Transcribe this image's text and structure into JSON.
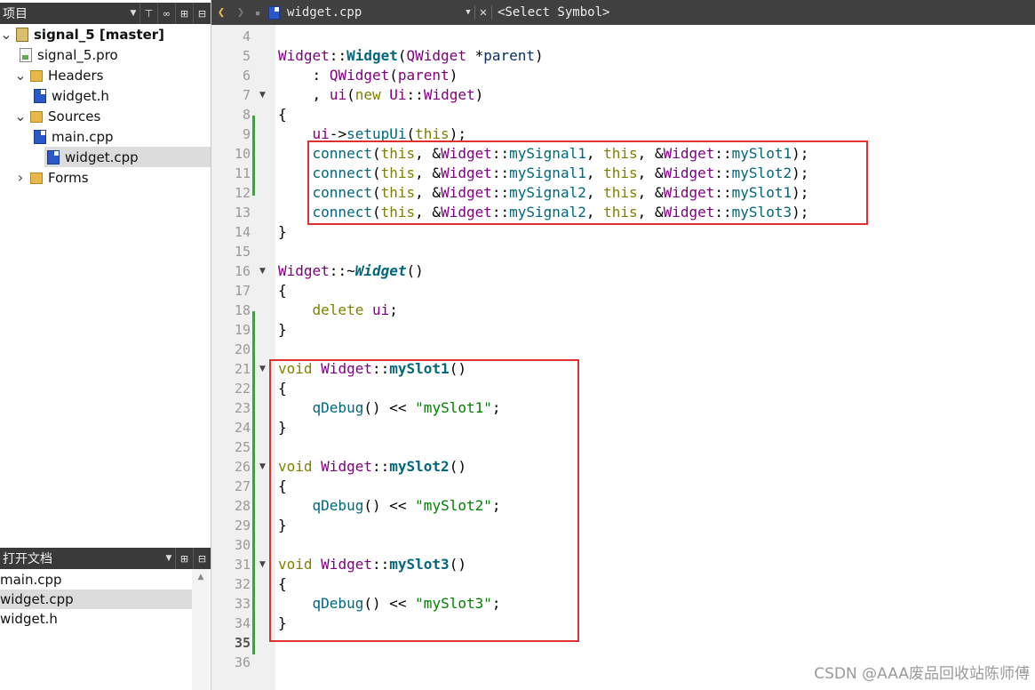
{
  "project_panel": {
    "title": "项目",
    "tree": [
      {
        "label": "signal_5 [master]",
        "icon": "project-icon",
        "expanded": true
      },
      {
        "label": "signal_5.pro",
        "icon": "pro-file-icon"
      },
      {
        "label": "Headers",
        "icon": "headers-folder-icon",
        "expanded": true
      },
      {
        "label": "widget.h",
        "icon": "cpp-file-icon"
      },
      {
        "label": "Sources",
        "icon": "sources-folder-icon",
        "expanded": true
      },
      {
        "label": "main.cpp",
        "icon": "cpp-file-icon"
      },
      {
        "label": "widget.cpp",
        "icon": "cpp-file-icon",
        "selected": true
      },
      {
        "label": "Forms",
        "icon": "forms-folder-icon",
        "expanded": false
      }
    ]
  },
  "open_docs": {
    "title": "打开文档",
    "items": [
      "main.cpp",
      "widget.cpp",
      "widget.h"
    ],
    "selected": "widget.cpp"
  },
  "editor": {
    "file_tab": "widget.cpp",
    "symbol_select": "<Select Symbol>",
    "current_line": "35",
    "lines": [
      {
        "n": "4",
        "t": ""
      },
      {
        "n": "5",
        "t": "Widget::Widget(QWidget *parent)"
      },
      {
        "n": "6",
        "t": "    : QWidget(parent)"
      },
      {
        "n": "7",
        "t": "    , ui(new Ui::Widget)"
      },
      {
        "n": "8",
        "t": "{"
      },
      {
        "n": "9",
        "t": "    ui->setupUi(this);"
      },
      {
        "n": "10",
        "t": "    connect(this, &Widget::mySignal1, this, &Widget::mySlot1);"
      },
      {
        "n": "11",
        "t": "    connect(this, &Widget::mySignal1, this, &Widget::mySlot2);"
      },
      {
        "n": "12",
        "t": "    connect(this, &Widget::mySignal2, this, &Widget::mySlot1);"
      },
      {
        "n": "13",
        "t": "    connect(this, &Widget::mySignal2, this, &Widget::mySlot3);"
      },
      {
        "n": "14",
        "t": "}"
      },
      {
        "n": "15",
        "t": ""
      },
      {
        "n": "16",
        "t": "Widget::~Widget()"
      },
      {
        "n": "17",
        "t": "{"
      },
      {
        "n": "18",
        "t": "    delete ui;"
      },
      {
        "n": "19",
        "t": "}"
      },
      {
        "n": "20",
        "t": ""
      },
      {
        "n": "21",
        "t": "void Widget::mySlot1()"
      },
      {
        "n": "22",
        "t": "{"
      },
      {
        "n": "23",
        "t": "    qDebug() << \"mySlot1\";"
      },
      {
        "n": "24",
        "t": "}"
      },
      {
        "n": "25",
        "t": ""
      },
      {
        "n": "26",
        "t": "void Widget::mySlot2()"
      },
      {
        "n": "27",
        "t": "{"
      },
      {
        "n": "28",
        "t": "    qDebug() << \"mySlot2\";"
      },
      {
        "n": "29",
        "t": "}"
      },
      {
        "n": "30",
        "t": ""
      },
      {
        "n": "31",
        "t": "void Widget::mySlot3()"
      },
      {
        "n": "32",
        "t": "{"
      },
      {
        "n": "33",
        "t": "    qDebug() << \"mySlot3\";"
      },
      {
        "n": "34",
        "t": "}"
      },
      {
        "n": "35",
        "t": ""
      },
      {
        "n": "36",
        "t": ""
      }
    ]
  },
  "watermark": "CSDN @AAA废品回收站陈师傅",
  "colors": {
    "highlight_box": "#e03030",
    "keyword": "#808000",
    "type": "#800080",
    "function": "#00677c",
    "string": "#008000"
  }
}
